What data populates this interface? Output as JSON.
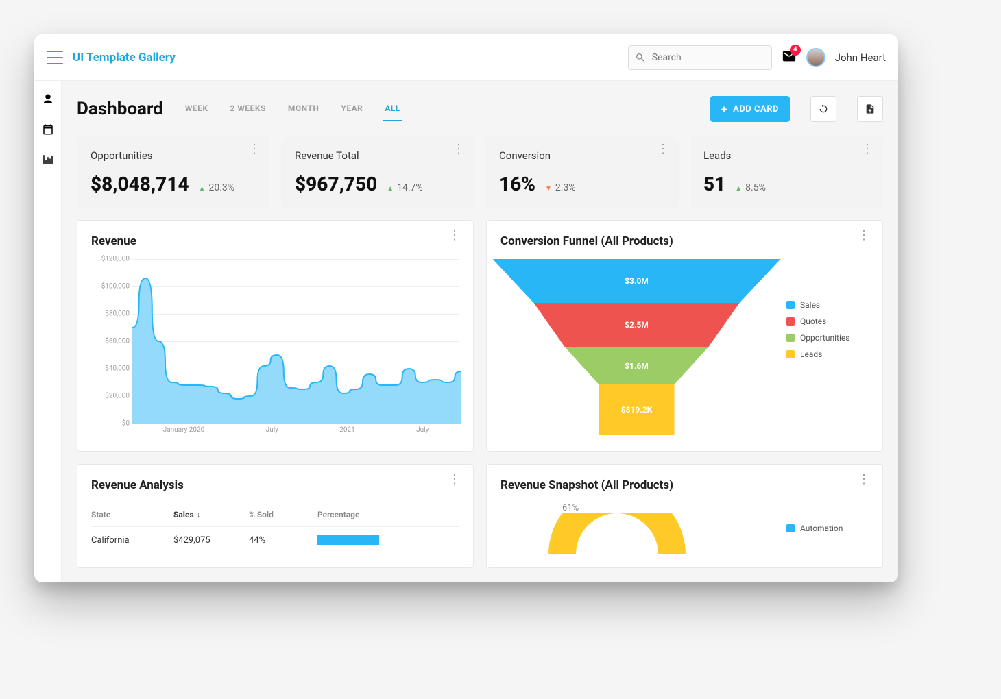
{
  "header": {
    "brand": "UI Template Gallery",
    "search_placeholder": "Search",
    "mail_count": "4",
    "user_name": "John Heart"
  },
  "page": {
    "title": "Dashboard",
    "tabs": [
      "WEEK",
      "2 WEEKS",
      "MONTH",
      "YEAR",
      "ALL"
    ],
    "active_tab": 4,
    "add_card_label": "ADD CARD"
  },
  "kpis": [
    {
      "label": "Opportunities",
      "value": "$8,048,714",
      "delta": "20.3%",
      "dir": "up"
    },
    {
      "label": "Revenue Total",
      "value": "$967,750",
      "delta": "14.7%",
      "dir": "up"
    },
    {
      "label": "Conversion",
      "value": "16%",
      "delta": "2.3%",
      "dir": "down"
    },
    {
      "label": "Leads",
      "value": "51",
      "delta": "8.5%",
      "dir": "up"
    }
  ],
  "revenue_panel": {
    "title": "Revenue"
  },
  "funnel_panel": {
    "title": "Conversion Funnel (All Products)",
    "legend": [
      {
        "name": "Sales",
        "color": "#29b6f6"
      },
      {
        "name": "Quotes",
        "color": "#ef5350"
      },
      {
        "name": "Opportunities",
        "color": "#9ccc65"
      },
      {
        "name": "Leads",
        "color": "#ffca28"
      }
    ],
    "segments": [
      {
        "label": "$3.0M",
        "color": "#29b6f6"
      },
      {
        "label": "$2.5M",
        "color": "#ef5350"
      },
      {
        "label": "$1.6M",
        "color": "#9ccc65"
      },
      {
        "label": "$819.2K",
        "color": "#ffca28"
      }
    ]
  },
  "analysis_panel": {
    "title": "Revenue Analysis",
    "columns": [
      "State",
      "Sales",
      "% Sold",
      "Percentage"
    ],
    "rows": [
      {
        "state": "California",
        "sales": "$429,075",
        "psold": "44%",
        "pct": 44
      }
    ]
  },
  "snapshot_panel": {
    "title": "Revenue Snapshot (All Products)",
    "donut_label": "61%",
    "legend_items": [
      "Automation"
    ]
  },
  "chart_data": {
    "revenue": {
      "type": "area",
      "ylabel": "",
      "ylim": [
        0,
        120000
      ],
      "yticks": [
        "$0",
        "$20,000",
        "$40,000",
        "$60,000",
        "$80,000",
        "$100,000",
        "$120,000"
      ],
      "xticks": [
        "January 2020",
        "July",
        "2021",
        "July"
      ],
      "values": [
        70000,
        106000,
        60000,
        30000,
        28000,
        28000,
        27000,
        22000,
        18000,
        20000,
        42000,
        50000,
        26000,
        25000,
        30000,
        42000,
        22000,
        25000,
        36000,
        28000,
        28000,
        40000,
        30000,
        32000,
        30000,
        38000
      ]
    },
    "funnel": {
      "type": "funnel",
      "series": [
        {
          "name": "Sales",
          "value": 3000000,
          "label": "$3.0M"
        },
        {
          "name": "Quotes",
          "value": 2500000,
          "label": "$2.5M"
        },
        {
          "name": "Opportunities",
          "value": 1600000,
          "label": "$1.6M"
        },
        {
          "name": "Leads",
          "value": 819200,
          "label": "$819.2K"
        }
      ]
    },
    "snapshot_donut": {
      "type": "pie",
      "series": [
        {
          "name": "Automation",
          "pct": 61
        }
      ]
    }
  }
}
